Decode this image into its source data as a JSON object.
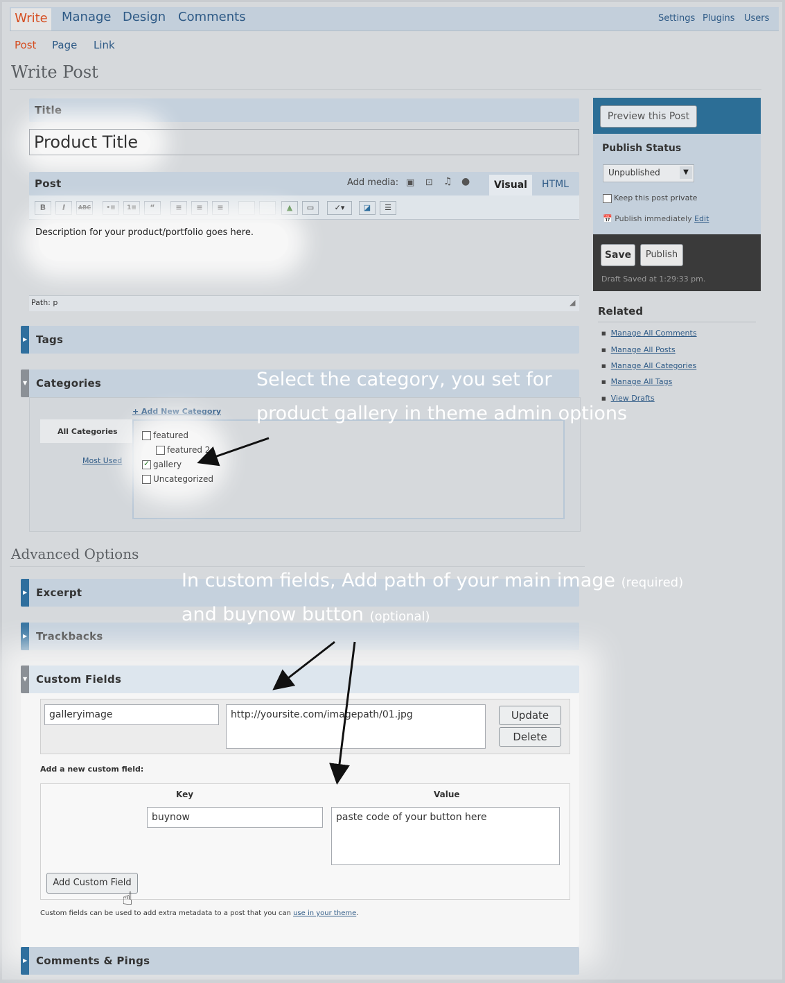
{
  "nav": {
    "tabs": [
      "Write",
      "Manage",
      "Design",
      "Comments"
    ],
    "links": [
      "Settings",
      "Plugins",
      "Users"
    ]
  },
  "subnav": [
    "Post",
    "Page",
    "Link"
  ],
  "page_title": "Write Post",
  "title_box": {
    "label": "Title",
    "value": "Product Title"
  },
  "post_box": {
    "label": "Post",
    "add_media": "Add media:",
    "tab_visual": "Visual",
    "tab_html": "HTML",
    "toolbar": [
      "B",
      "I",
      "ABC",
      "•≡",
      "1≡",
      "“",
      "≡",
      "≡",
      "≡"
    ],
    "content": "Description for your product/portfolio goes here.",
    "path": "Path: p"
  },
  "sidebar": {
    "preview_button": "Preview this Post",
    "publish_status_label": "Publish Status",
    "status_value": "Unpublished",
    "keep_private": "Keep this post private",
    "publish_immediately": "Publish immediately",
    "edit_link": "Edit",
    "save_button": "Save",
    "publish_button": "Publish",
    "draft_saved": "Draft Saved at 1:29:33 pm.",
    "related_label": "Related",
    "related_links": [
      "Manage All Comments",
      "Manage All Posts",
      "Manage All Categories",
      "Manage All Tags",
      "View Drafts"
    ]
  },
  "tags_label": "Tags",
  "categories": {
    "label": "Categories",
    "add_new": "+ Add New Category",
    "all_tab": "All Categories",
    "most_used": "Most Used",
    "items": [
      {
        "name": "featured",
        "checked": false
      },
      {
        "name": "featured 2",
        "checked": false
      },
      {
        "name": "gallery",
        "checked": true
      },
      {
        "name": "Uncategorized",
        "checked": false
      }
    ]
  },
  "note_category": {
    "line1": "Select the category, you set for",
    "line2": "product gallery in theme admin options"
  },
  "advanced_title": "Advanced Options",
  "excerpt_label": "Excerpt",
  "trackbacks_label": "Trackbacks",
  "note_fields": {
    "line1": "In custom fields, Add path of your main image",
    "line1_small": "(required)",
    "line2": "and buynow button",
    "line2_small": "(optional)"
  },
  "custom_fields": {
    "label": "Custom Fields",
    "existing_key": "galleryimage",
    "existing_value": "http://yoursite.com/imagepath/01.jpg",
    "update_button": "Update",
    "delete_button": "Delete",
    "add_new_label": "Add a new custom field:",
    "key_header": "Key",
    "value_header": "Value",
    "new_key": "buynow",
    "new_value": "paste code of your button here",
    "add_button": "Add Custom Field",
    "help_text": "Custom fields can be used to add extra metadata to a post that you can",
    "help_link": "use in your theme",
    "help_end": "."
  },
  "comments_label": "Comments & Pings"
}
